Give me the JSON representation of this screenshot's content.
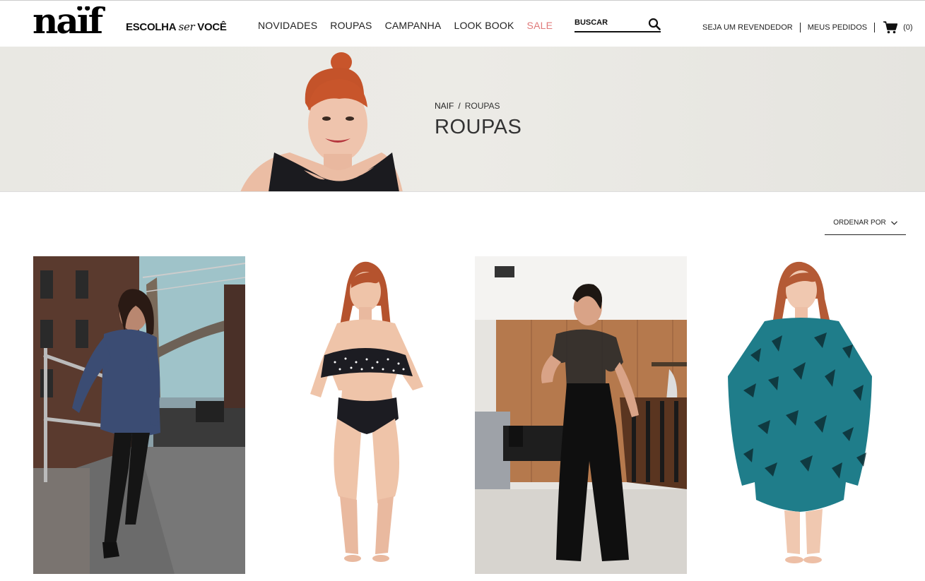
{
  "header": {
    "logo_text": "naïf",
    "tagline_prefix": "ESCOLHA",
    "tagline_ser": "ser",
    "tagline_suffix": "VOCÊ",
    "nav": [
      {
        "label": "NOVIDADES"
      },
      {
        "label": "ROUPAS"
      },
      {
        "label": "CAMPANHA"
      },
      {
        "label": "LOOK BOOK"
      },
      {
        "label": "SALE",
        "color": "#e07a7a"
      }
    ],
    "search_placeholder": "BUSCAR",
    "search_icon": "search-icon",
    "reseller_label": "SEJA UM REVENDEDOR",
    "orders_label": "MEUS PEDIDOS",
    "cart_icon": "cart-icon",
    "cart_count": "(0)"
  },
  "banner": {
    "breadcrumb": [
      {
        "label": "NAIF"
      },
      {
        "label": "ROUPAS"
      }
    ],
    "breadcrumb_separator": "/",
    "title": "ROUPAS"
  },
  "sort": {
    "label": "ORDENAR POR",
    "icon": "chevron-down-icon"
  },
  "products": [
    {
      "image": "denim-shirt-dress-model"
    },
    {
      "image": "polka-dot-bikini-model"
    },
    {
      "image": "black-jumpsuit-model"
    },
    {
      "image": "teal-kaftan-model"
    }
  ],
  "colors": {
    "accent_sale": "#e07a7a",
    "text": "#222222",
    "banner_bg": "#ebeae5"
  }
}
